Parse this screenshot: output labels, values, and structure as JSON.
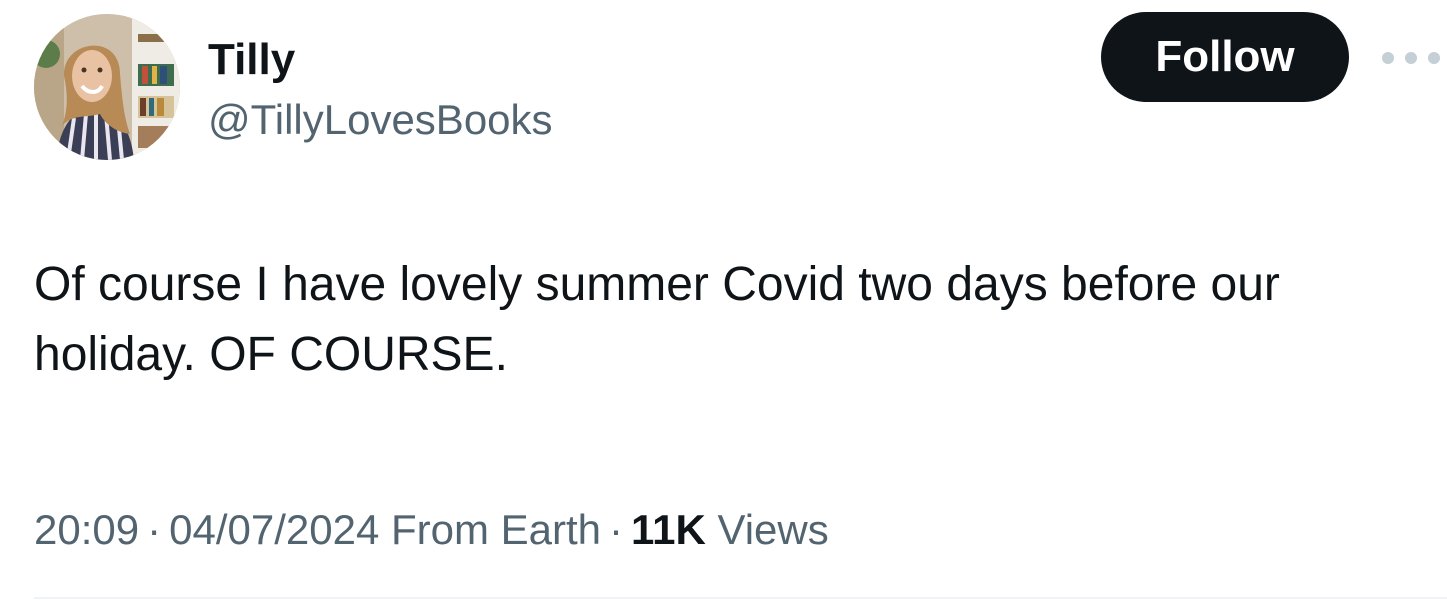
{
  "author": {
    "name": "Tilly",
    "handle": "@TillyLovesBooks",
    "avatar_icon": "profile-photo-icon"
  },
  "actions": {
    "follow_label": "Follow",
    "more_icon": "more-options-icon"
  },
  "tweet": {
    "text": "Of course I have lovely summer Covid two days before our holiday. OF COURSE."
  },
  "meta": {
    "time": "20:09",
    "separator": "·",
    "date": "04/07/2024",
    "source": "From Earth",
    "views_count": "11K",
    "views_label": "Views"
  },
  "colors": {
    "primary_text": "#0f1419",
    "secondary_text": "#536471",
    "button_bg": "#0f1419",
    "button_text": "#ffffff",
    "divider": "#eff3f4"
  }
}
